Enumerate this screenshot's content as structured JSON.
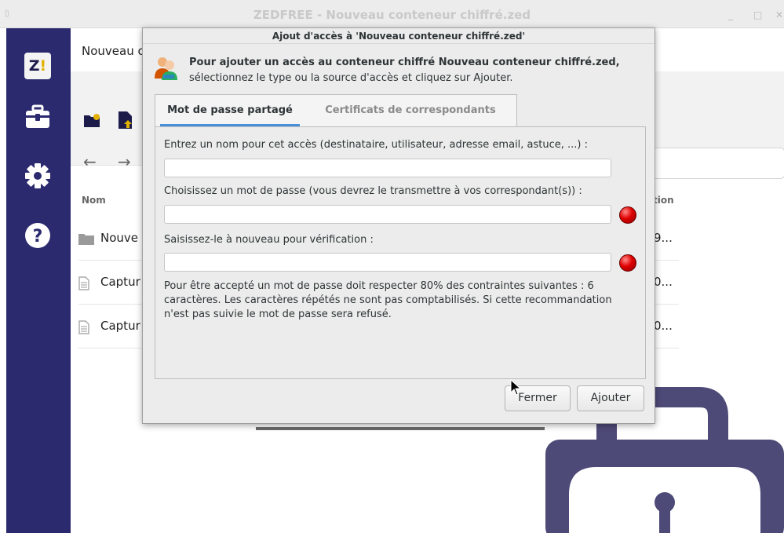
{
  "window": {
    "title": "ZEDFREE - Nouveau conteneur chiffré.zed",
    "menu_glyph": "▯",
    "min_glyph": "_",
    "max_glyph": "□",
    "close_glyph": "✕"
  },
  "sidebar": {
    "logo_text": "Z",
    "logo_bang": "!",
    "items": [
      {
        "icon": "logo-icon"
      },
      {
        "icon": "briefcase-icon"
      },
      {
        "icon": "gear-icon"
      },
      {
        "icon": "help-icon"
      }
    ]
  },
  "app": {
    "container_title": "Nouveau c",
    "nav_back": "←",
    "nav_forward": "→",
    "col_name": "Nom",
    "col_right": "tion",
    "rows": [
      {
        "name": "Nouve",
        "val": "9...",
        "icon": "folder-icon"
      },
      {
        "name": "Captur",
        "val": "0...",
        "icon": "file-icon"
      },
      {
        "name": "Captur",
        "val": "0...",
        "icon": "file-icon"
      }
    ]
  },
  "dialog": {
    "title": "Ajout d'accès à 'Nouveau conteneur chiffré.zed'",
    "header_line1": "Pour ajouter un accès au conteneur chiffré Nouveau conteneur chiffré.zed,",
    "header_line2": "sélectionnez le type ou la source d'accès et cliquez sur Ajouter.",
    "tabs": {
      "shared_password": "Mot de passe partagé",
      "certificates": "Certificats de correspondants"
    },
    "name_label": "Entrez un nom pour cet accès (destinataire, utilisateur, adresse email, astuce, ...) :",
    "name_value": "",
    "password_label": "Choisissez un mot de passe (vous devrez le transmettre à vos correspondant(s)) :",
    "password_value": "",
    "confirm_label": "Saisissez-le à nouveau pour vérification :",
    "confirm_value": "",
    "note": "Pour être accepté un mot de passe doit respecter 80% des contraintes suivantes : 6 caractères. Les caractères répétés ne sont pas comptabilisés. Si cette recommandation n'est pas suivie le mot de passe sera refusé.",
    "close_label": "Fermer",
    "add_label": "Ajouter",
    "status_color": "#e00000"
  }
}
